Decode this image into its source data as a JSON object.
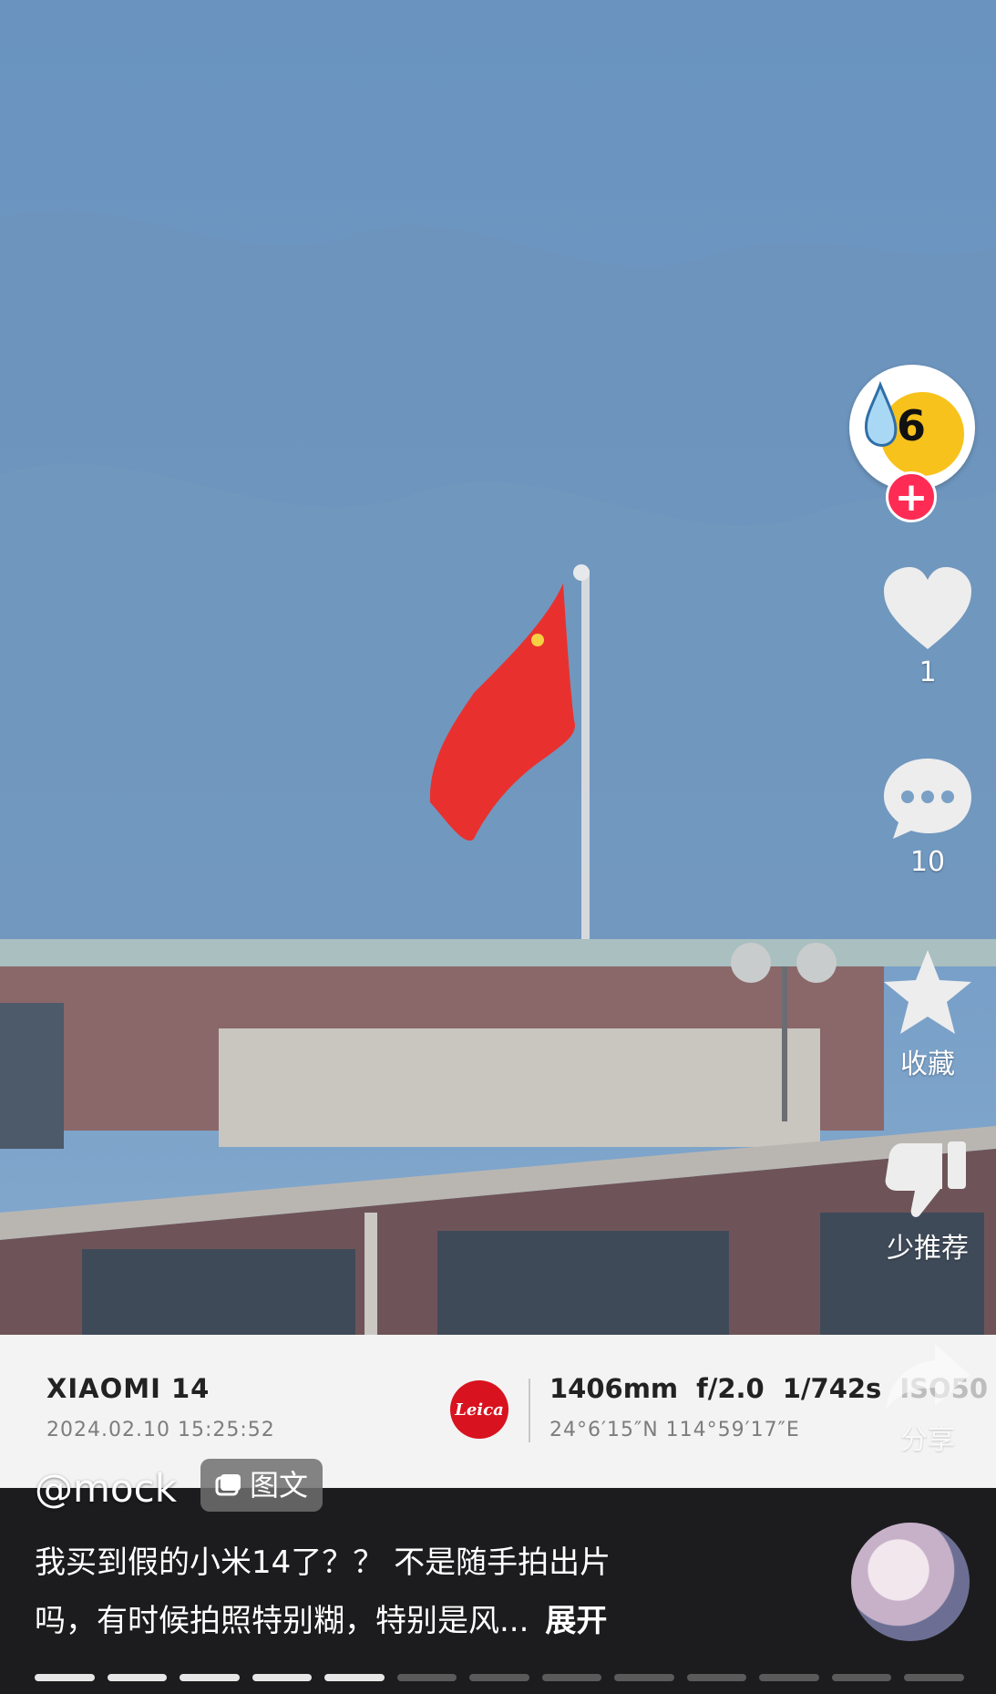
{
  "rail": {
    "avatar_badge": "6",
    "follow": "+",
    "like_count": "1",
    "comment_count": "10",
    "favorite_label": "收藏",
    "dislike_label": "少推荐",
    "share_label": "分享"
  },
  "exif": {
    "model": "XIAOMI 14",
    "datetime": "2024.02.10 15:25:52",
    "brand": "Leica",
    "focal": "1406mm",
    "aperture": "f/2.0",
    "shutter": "1/742s",
    "iso": "ISO50",
    "gps": "24°6′15″N  114°59′17″E"
  },
  "post": {
    "handle": "@mock",
    "type_badge": "图文",
    "caption_line1": "我买到假的小米14了？？ 不是随手拍出片",
    "caption_line2": "吗，有时候拍照特别糊，特别是风...",
    "expand": "展开"
  },
  "progress": {
    "total": 13,
    "done": 5
  },
  "colors": {
    "accent": "#fe2c55",
    "leica": "#d9121f",
    "flag": "#e8312e"
  }
}
